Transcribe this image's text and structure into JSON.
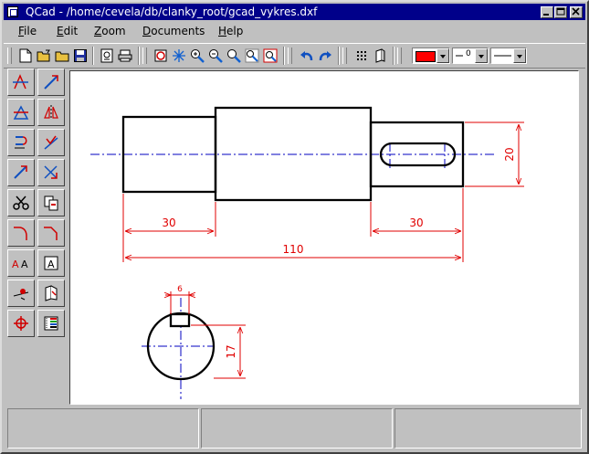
{
  "window": {
    "title": "QCad - /home/cevela/db/clanky_root/gcad_vykres.dxf"
  },
  "menubar": [
    {
      "label": "File"
    },
    {
      "label": "Edit"
    },
    {
      "label": "Zoom"
    },
    {
      "label": "Documents"
    },
    {
      "label": "Help"
    }
  ],
  "toolbar": {
    "color_value": "#ff0000",
    "line_width_value": "0",
    "line_style_value": "solid"
  },
  "drawing": {
    "dimensions": [
      "30",
      "30",
      "110",
      "20",
      "6",
      "17"
    ]
  },
  "colors": {
    "geometry": "#000000",
    "dimension": "#e00000",
    "centerline": "#0000c0",
    "titlebar": "#00008a"
  }
}
